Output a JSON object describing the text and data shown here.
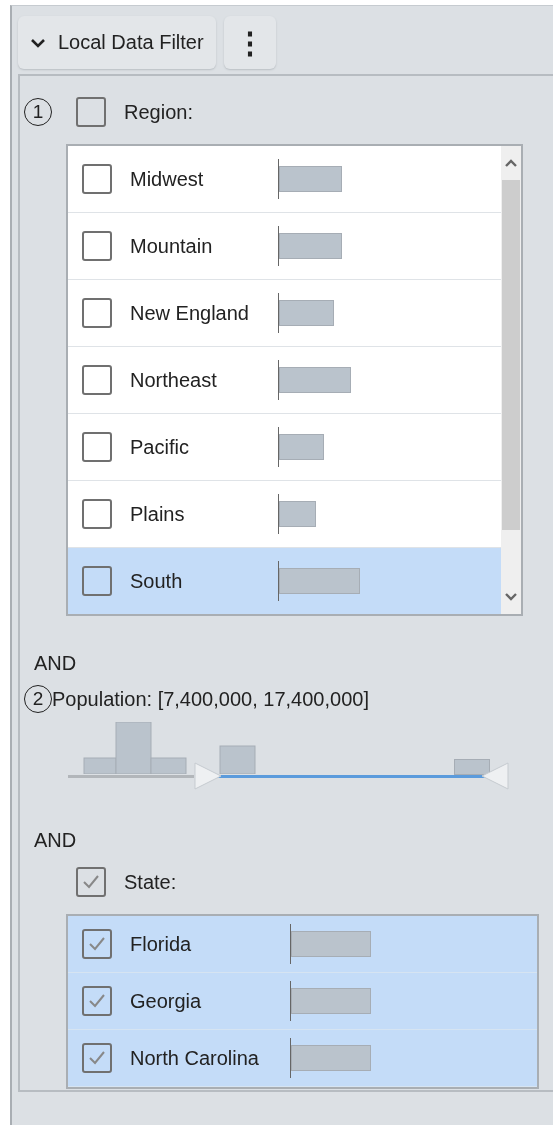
{
  "header": {
    "title": "Local Data Filter",
    "expanded": true,
    "menu_label": "⋮"
  },
  "filters": [
    {
      "kind": "list",
      "number": "1",
      "label": "Region:",
      "checked": false,
      "scrollable": true,
      "items": [
        {
          "label": "Midwest",
          "checked": false,
          "selected": false,
          "level": 0.63
        },
        {
          "label": "Mountain",
          "checked": false,
          "selected": false,
          "level": 0.63
        },
        {
          "label": "New England",
          "checked": false,
          "selected": false,
          "level": 0.55
        },
        {
          "label": "Northeast",
          "checked": false,
          "selected": false,
          "level": 0.72
        },
        {
          "label": "Pacific",
          "checked": false,
          "selected": false,
          "level": 0.45
        },
        {
          "label": "Plains",
          "checked": false,
          "selected": false,
          "level": 0.37
        },
        {
          "label": "South",
          "checked": false,
          "selected": true,
          "level": 0.81
        }
      ]
    },
    {
      "kind": "range",
      "connector": "AND",
      "number": "2",
      "label": "Population: [7,400,000, 17,400,000]",
      "start": {
        "level": 0.32
      },
      "end": {
        "level": 0.98
      }
    },
    {
      "kind": "list",
      "connector": "AND",
      "label": "State:",
      "checked": true,
      "scrollable": false,
      "items": [
        {
          "label": "Florida",
          "checked": true,
          "selected": true,
          "level": 0.8
        },
        {
          "label": "Georgia",
          "checked": true,
          "selected": true,
          "level": 0.8
        },
        {
          "label": "North Carolina",
          "checked": true,
          "selected": true,
          "level": 0.8
        }
      ]
    }
  ]
}
